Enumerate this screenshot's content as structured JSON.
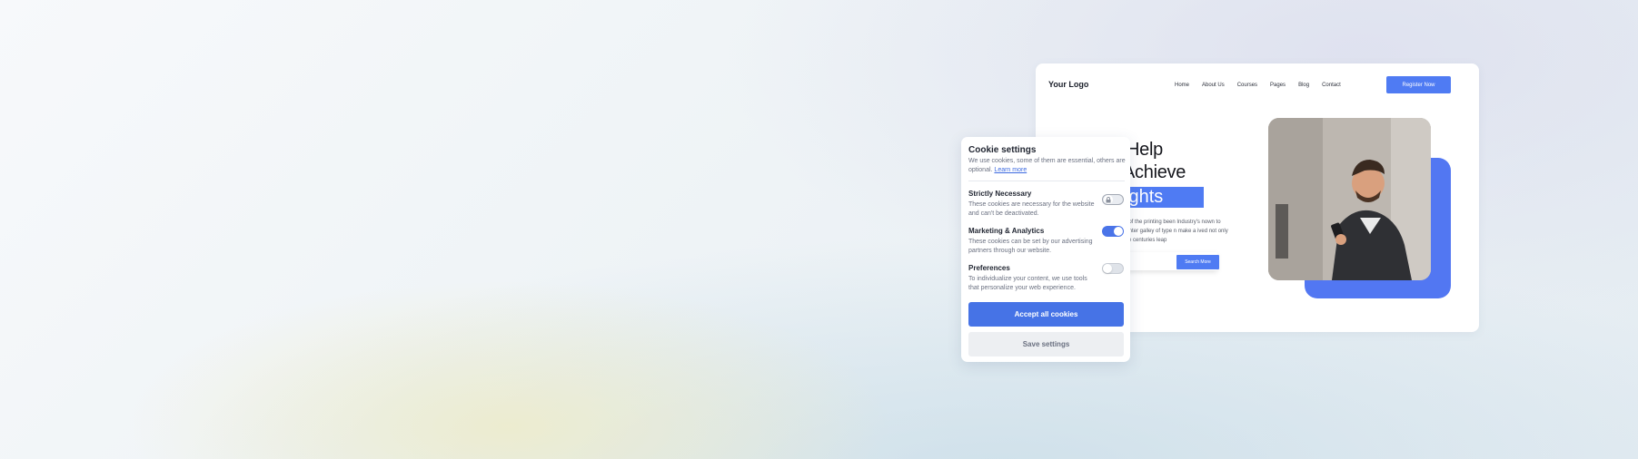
{
  "website": {
    "logo": "Your Logo",
    "nav": [
      "Home",
      "About Us",
      "Courses",
      "Pages",
      "Blog",
      "Contact"
    ],
    "register_label": "Register Now",
    "hero_line1": "Help",
    "hero_line2": "Achieve",
    "hero_highlight": "ights",
    "hero_desc": "xt of the printing  been Industry's nown to printer galley of type n make a ived not only five centuries leap",
    "search_label": "Search More",
    "accent_color": "#4f7bf3"
  },
  "cookie": {
    "title": "Cookie settings",
    "intro": "We use cookies, some of them are essential, others are optional.",
    "learn_more": "Learn more",
    "sections": [
      {
        "heading": "Strictly Necessary",
        "desc": "These cookies are necessary for the website and can't be deactivated.",
        "state": "locked"
      },
      {
        "heading": "Marketing & Analytics",
        "desc": "These cookies can be set by our advertising partners through our website.",
        "state": "on"
      },
      {
        "heading": "Preferences",
        "desc": "To individualize your content, we use tools that personalize your web experience.",
        "state": "off"
      }
    ],
    "accept_label": "Accept all cookies",
    "save_label": "Save settings",
    "accent_color": "#4673e6"
  }
}
